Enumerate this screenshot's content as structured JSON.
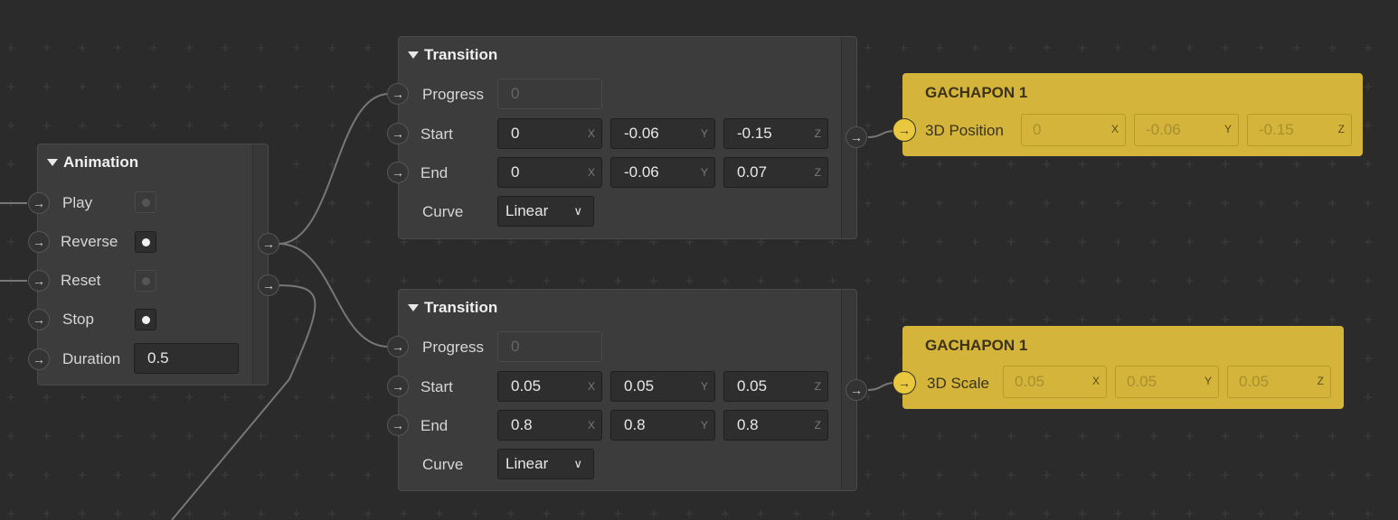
{
  "animation": {
    "title": "Animation",
    "inputs": [
      {
        "label": "Play",
        "checked": false
      },
      {
        "label": "Reverse",
        "checked": true
      },
      {
        "label": "Reset",
        "checked": false
      },
      {
        "label": "Stop",
        "checked": true
      },
      {
        "label": "Duration",
        "value": "0.5"
      }
    ]
  },
  "transition1": {
    "title": "Transition",
    "progress_label": "Progress",
    "progress_value": "0",
    "start_label": "Start",
    "start": [
      "0",
      "-0.06",
      "-0.15"
    ],
    "end_label": "End",
    "end": [
      "0",
      "-0.06",
      "0.07"
    ],
    "curve_label": "Curve",
    "curve_value": "Linear"
  },
  "transition2": {
    "title": "Transition",
    "progress_label": "Progress",
    "progress_value": "0",
    "start_label": "Start",
    "start": [
      "0.05",
      "0.05",
      "0.05"
    ],
    "end_label": "End",
    "end": [
      "0.8",
      "0.8",
      "0.8"
    ],
    "curve_label": "Curve",
    "curve_value": "Linear"
  },
  "axes": [
    "X",
    "Y",
    "Z"
  ],
  "gachapon1": {
    "title": "GACHAPON 1",
    "property_label": "3D Position",
    "values": [
      "0",
      "-0.06",
      "-0.15"
    ]
  },
  "gachapon2": {
    "title": "GACHAPON 1",
    "property_label": "3D Scale",
    "values": [
      "0.05",
      "0.05",
      "0.05"
    ]
  },
  "colors": {
    "canvas": "#2b2b2b",
    "node": "#3c3c3c",
    "object_node": "#d4b43a"
  },
  "icons": {
    "port": "arrow-right-icon",
    "collapse": "triangle-down-icon",
    "dropdown": "chevron-down-icon"
  }
}
